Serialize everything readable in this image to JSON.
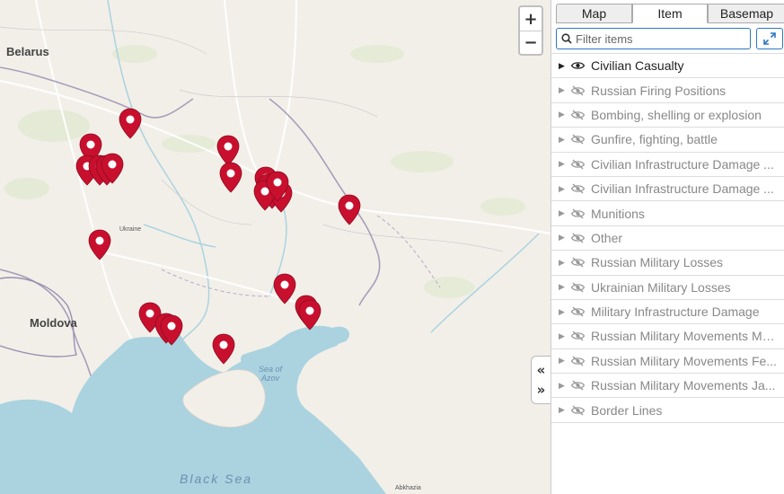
{
  "map": {
    "labels": {
      "belarus": "Belarus",
      "moldova": "Moldova",
      "ukraine": "Ukraine",
      "black_sea": "Black Sea",
      "sea_of_azov_line1": "Sea of",
      "sea_of_azov_line2": "Azov",
      "abkhazia": "Abkhazia"
    },
    "zoom_in": "+",
    "zoom_out": "−",
    "pin_color": "#c8102e",
    "water_color": "#aad3df",
    "land_color": "#f2efe9",
    "pin_count": 26
  },
  "panel": {
    "tabs": [
      "Map",
      "Item",
      "Basemap"
    ],
    "active_tab": "Item",
    "filter_placeholder": "Filter items",
    "layers": [
      {
        "name": "Civilian Casualty",
        "visible": true
      },
      {
        "name": "Russian Firing Positions",
        "visible": false
      },
      {
        "name": "Bombing, shelling or explosion",
        "visible": false
      },
      {
        "name": "Gunfire, fighting, battle",
        "visible": false
      },
      {
        "name": "Civilian Infrastructure Damage ...",
        "visible": false
      },
      {
        "name": "Civilian Infrastructure Damage ...",
        "visible": false
      },
      {
        "name": "Munitions",
        "visible": false
      },
      {
        "name": "Other",
        "visible": false
      },
      {
        "name": "Russian Military Losses",
        "visible": false
      },
      {
        "name": "Ukrainian Military Losses",
        "visible": false
      },
      {
        "name": "Military Infrastructure Damage",
        "visible": false
      },
      {
        "name": "Russian Military Movements Ma...",
        "visible": false
      },
      {
        "name": "Russian Military Movements Fe...",
        "visible": false
      },
      {
        "name": "Russian Military Movements Ja...",
        "visible": false
      },
      {
        "name": "Border Lines",
        "visible": false
      }
    ]
  }
}
